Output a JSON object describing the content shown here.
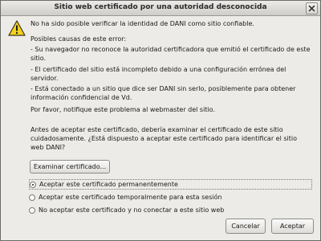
{
  "window": {
    "title": "Sitio web certificado por una autoridad desconocida"
  },
  "message": {
    "headline": "No ha sido posible verificar la identidad de DANI como sitio confiable.",
    "causes_title": "Posibles causas de este error:",
    "causes": [
      "- Su navegador no reconoce la autoridad certificadora que emitió el certificado de este sitio.",
      "- El certificado del sitio está incompleto debido a una configuración errónea del servidor.",
      "- Está conectado a un sitio que dice ser DANI sin serlo, posiblemente para obtener información confidencial de Vd."
    ],
    "notify": "Por favor, notifique este problema al webmaster del sitio.",
    "question": "Antes de aceptar este certificado, debería examinar el certificado de este sitio cuidadosamente. ¿Está dispuesto a aceptar este certificado para identificar el sitio web DANI?"
  },
  "examine_button": "Examinar certificado...",
  "options": [
    {
      "label": "Aceptar este certificado permanentemente",
      "checked": true
    },
    {
      "label": "Aceptar este certificado temporalmente para esta sesión",
      "checked": false
    },
    {
      "label": "No aceptar este certificado y no conectar a este sitio web",
      "checked": false
    }
  ],
  "buttons": {
    "cancel": "Cancelar",
    "accept": "Aceptar"
  },
  "icons": {
    "warning": "warning-icon",
    "close": "close-icon"
  },
  "colors": {
    "warning_fill": "#f5d21b",
    "window_bg": "#edebe7"
  }
}
